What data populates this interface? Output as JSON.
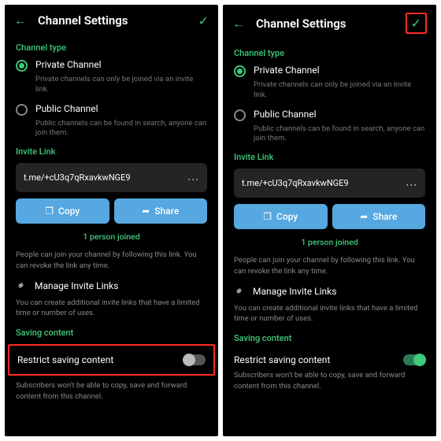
{
  "left": {
    "header": {
      "title": "Channel Settings"
    },
    "channel_type": {
      "label": "Channel type",
      "private": {
        "name": "Private Channel",
        "desc": "Private channels can only be joined via an invite link."
      },
      "public": {
        "name": "Public Channel",
        "desc": "Public channels can be found in search, anyone can join them."
      }
    },
    "invite": {
      "label": "Invite Link",
      "link": "t.me/+cU3q7qRxavkwNGE9",
      "copy": "Copy",
      "share": "Share",
      "joined": "1 person joined",
      "desc": "People can join your channel by following this link. You can revoke the link any time.",
      "manage": "Manage Invite Links",
      "manage_desc": "You can create additional invite links that have a limited time or number of uses."
    },
    "saving": {
      "label": "Saving content",
      "restrict": "Restrict saving content",
      "desc": "Subscribers won't be able to copy, save and forward content from this channel."
    }
  },
  "right": {
    "header": {
      "title": "Channel Settings"
    },
    "channel_type": {
      "label": "Channel type",
      "private": {
        "name": "Private Channel",
        "desc": "Private channels can only be joined via an invite link."
      },
      "public": {
        "name": "Public Channel",
        "desc": "Public channels can be found in search, anyone can join them."
      }
    },
    "invite": {
      "label": "Invite Link",
      "link": "t.me/+cU3q7qRxavkwNGE9",
      "copy": "Copy",
      "share": "Share",
      "joined": "1 person joined",
      "desc": "People can join your channel by following this link. You can revoke the link any time.",
      "manage": "Manage Invite Links",
      "manage_desc": "You can create additional invite links that have a limited time or number of uses."
    },
    "saving": {
      "label": "Saving content",
      "restrict": "Restrict saving content",
      "desc": "Subscribers won't be able to copy, save and forward content from this channel."
    }
  }
}
